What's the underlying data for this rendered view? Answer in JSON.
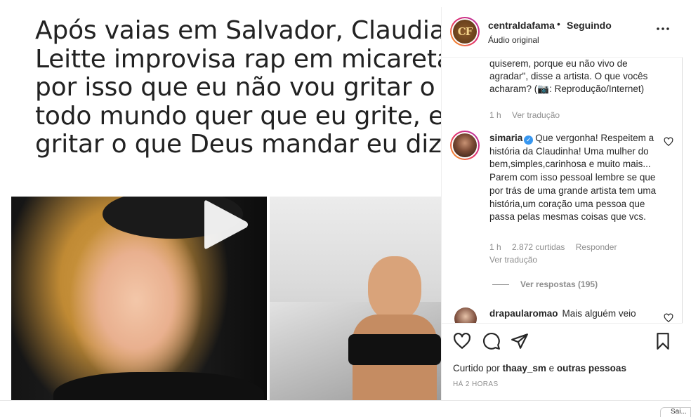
{
  "post": {
    "headline_lines": [
      "Após vaias em Salvador, Claudia",
      "Leitte improvisa rap em micareta: \"É",
      "por isso que eu não vou gritar o que",
      "todo mundo quer que eu grite, eu vou",
      "gritar o que Deus mandar eu dizer\""
    ],
    "play_icon": "play-icon"
  },
  "header": {
    "avatar_text": "CF",
    "username": "centraldafama",
    "separator": "•",
    "follow_status": "Seguindo",
    "audio": "Áudio original",
    "more_icon": "more-horizontal-icon"
  },
  "comments": {
    "caption_lines": [
      "quiserem, porque eu não vivo de",
      "agradar\", disse a artista. O que vocês",
      "acharam? (📷: Reprodução/Internet)"
    ],
    "caption_meta": {
      "time": "1 h",
      "translate": "Ver tradução"
    },
    "comment2": {
      "author": "simaria",
      "text": "Que vergonha! Respeitem a história da Claudinha! Uma mulher do bem,simples,carinhosa e muito mais... Parem com isso pessoal lembre se que por trás de uma grande artista tem uma história,um coração uma pessoa que passa pelas mesmas coisas que vcs.",
      "time": "1 h",
      "likes": "2.872 curtidas",
      "reply": "Responder",
      "translate": "Ver tradução",
      "view_replies": "Ver respostas (195)"
    },
    "comment3": {
      "author": "drapaularomao",
      "text": "Mais alguém veio"
    }
  },
  "actions": {
    "liked_by_prefix": "Curtido por",
    "liked_by_user": "thaay_sm",
    "liked_by_and": "e",
    "liked_by_others": "outras pessoas",
    "timestamp": "HÁ 2 HORAS"
  },
  "footer": {
    "corner_text": "Sai..."
  },
  "colors": {
    "text": "#262626",
    "muted": "#8e8e8e",
    "verified": "#3897f0"
  }
}
